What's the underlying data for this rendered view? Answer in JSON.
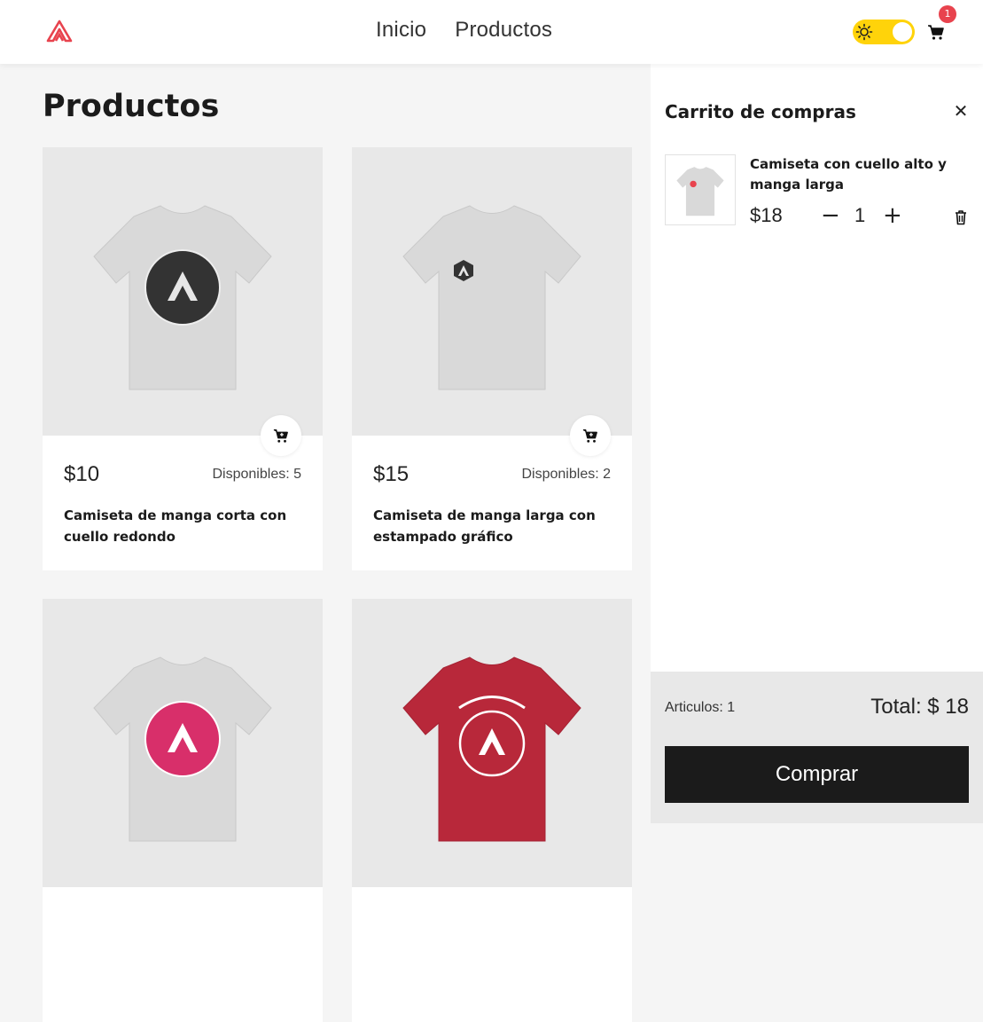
{
  "header": {
    "nav": [
      "Inicio",
      "Productos"
    ],
    "cart_badge": "1",
    "theme_toggle": "light",
    "colors": {
      "brand": "#e8434e",
      "toggle": "#ffd30a"
    }
  },
  "main": {
    "title": "Productos",
    "products": [
      {
        "price": "$10",
        "stock": "Disponibles: 5",
        "name": "Camiseta de manga corta con cuello redondo",
        "shirt_color": "#d9d9d9",
        "print": "round-logo-dark"
      },
      {
        "price": "$15",
        "stock": "Disponibles: 2",
        "name": "Camiseta de manga larga con estampado gráfico",
        "shirt_color": "#d9d9d9",
        "print": "small-logo"
      },
      {
        "price": "",
        "stock": "",
        "name": "",
        "shirt_color": "#d9d9d9",
        "print": "round-logo-pink"
      },
      {
        "price": "",
        "stock": "",
        "name": "",
        "shirt_color": "#b8283a",
        "print": "round-logo-white"
      }
    ]
  },
  "cart": {
    "title": "Carrito de compras",
    "close_icon": "close-icon",
    "items": [
      {
        "name": "Camiseta con cuello alto y manga larga",
        "price": "$18",
        "quantity": "1",
        "minus": "−",
        "plus": "+"
      }
    ],
    "count_label": "Articulos: 1",
    "total_label": "Total: $ 18",
    "buy_label": "Comprar"
  }
}
